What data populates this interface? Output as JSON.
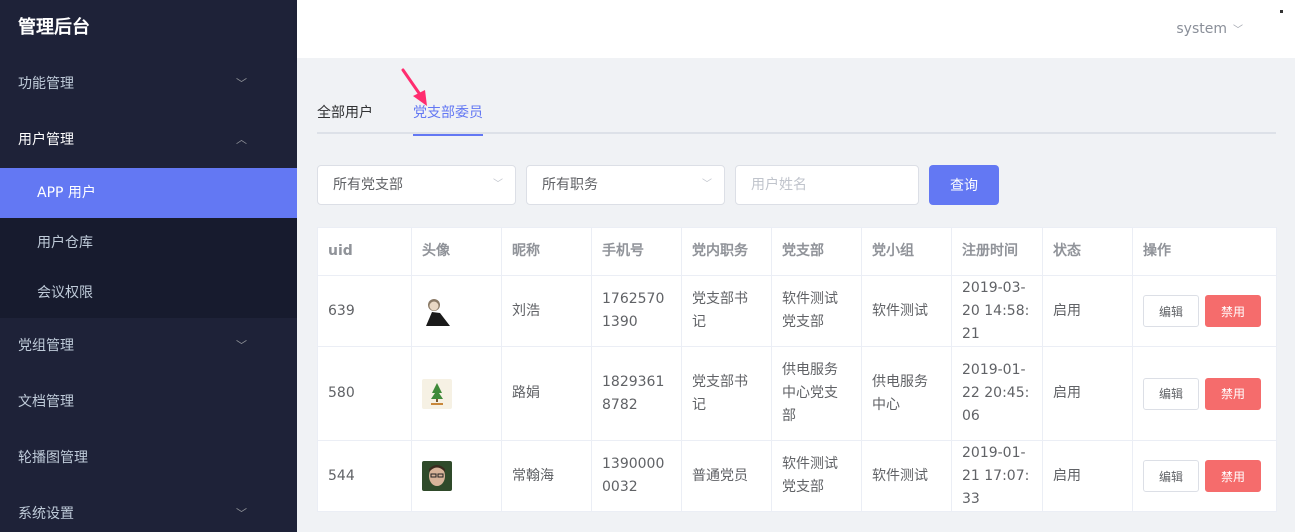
{
  "app": {
    "title": "管理后台"
  },
  "sidebar": {
    "items": [
      {
        "label": "功能管理"
      },
      {
        "label": "用户管理"
      },
      {
        "label": "党组管理"
      },
      {
        "label": "文档管理"
      },
      {
        "label": "轮播图管理"
      },
      {
        "label": "系统设置"
      }
    ],
    "submenu": [
      {
        "label": "APP 用户"
      },
      {
        "label": "用户仓库"
      },
      {
        "label": "会议权限"
      }
    ]
  },
  "header": {
    "user": "system"
  },
  "tabs": [
    {
      "label": "全部用户"
    },
    {
      "label": "党支部委员"
    }
  ],
  "filters": {
    "branch": "所有党支部",
    "position": "所有职务",
    "name_placeholder": "用户姓名",
    "query_label": "查询"
  },
  "table": {
    "headers": [
      "uid",
      "头像",
      "昵称",
      "手机号",
      "党内职务",
      "党支部",
      "党小组",
      "注册时间",
      "状态",
      "操作"
    ],
    "rows": [
      {
        "uid": "639",
        "avatar": "avatar-person-icon",
        "nickname": "刘浩",
        "phone": "17625701390",
        "position": "党支部书记",
        "branch": "软件测试党支部",
        "group": "软件测试",
        "registered": "2019-03-20 14:58:21",
        "status": "启用"
      },
      {
        "uid": "580",
        "avatar": "avatar-plant-icon",
        "nickname": "路娟",
        "phone": "18293618782",
        "position": "党支部书记",
        "branch": "供电服务中心党支部",
        "group": "供电服务中心",
        "registered": "2019-01-22 20:45:06",
        "status": "启用"
      },
      {
        "uid": "544",
        "avatar": "avatar-face-icon",
        "nickname": "常翰海",
        "phone": "13900000032",
        "position": "普通党员",
        "branch": "软件测试党支部",
        "group": "软件测试",
        "registered": "2019-01-21 17:07:33",
        "status": "启用"
      }
    ],
    "actions": {
      "edit": "编辑",
      "ban": "禁用"
    }
  },
  "colors": {
    "accent": "#6378f3",
    "danger": "#f56c6c",
    "sidebar": "#1e2238",
    "annotation_arrow": "#ff2d6f"
  }
}
